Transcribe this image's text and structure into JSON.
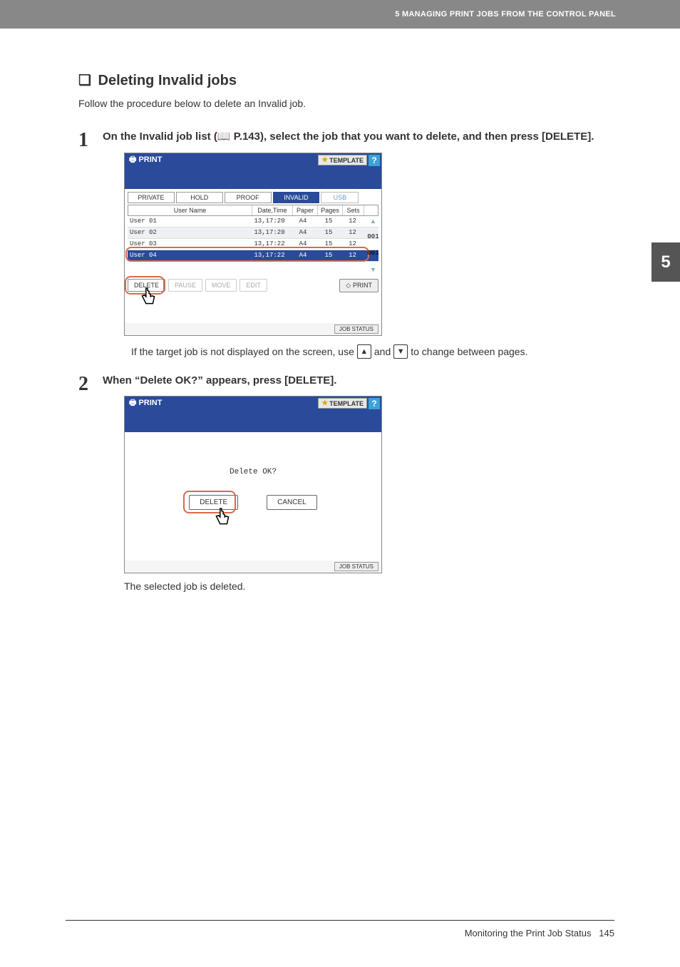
{
  "header": {
    "chapter_label": "5 MANAGING PRINT JOBS FROM THE CONTROL PANEL"
  },
  "chapter_tab": "5",
  "section": {
    "title": "Deleting Invalid jobs",
    "intro": "Follow the procedure below to delete an Invalid job."
  },
  "step1": {
    "num": "1",
    "heading_a": "On the Invalid job list (",
    "heading_ref": "P.143",
    "heading_b": "), select the job that you want to delete, and then press [DELETE].",
    "note_a": "If the target job is not displayed on the screen, use",
    "note_b": "and",
    "note_c": "to change between pages."
  },
  "step2": {
    "num": "2",
    "heading": "When “Delete OK?” appears, press [DELETE].",
    "after": "The selected job is deleted."
  },
  "panel1": {
    "title": "PRINT",
    "template": "TEMPLATE",
    "help": "?",
    "tabs": {
      "private": "PRIVATE",
      "hold": "HOLD",
      "proof": "PROOF",
      "invalid": "INVALID",
      "usb": "USB"
    },
    "cols": {
      "user": "User Name",
      "dt": "Date,Time",
      "paper": "Paper",
      "pages": "Pages",
      "sets": "Sets"
    },
    "rows": [
      {
        "user": "User 01",
        "dt": "13,17:20",
        "paper": "A4",
        "pages": "15",
        "sets": "12"
      },
      {
        "user": "User 02",
        "dt": "13,17:20",
        "paper": "A4",
        "pages": "15",
        "sets": "12"
      },
      {
        "user": "User 03",
        "dt": "13,17:22",
        "paper": "A4",
        "pages": "15",
        "sets": "12"
      },
      {
        "user": "User 04",
        "dt": "13,17:22",
        "paper": "A4",
        "pages": "15",
        "sets": "12"
      }
    ],
    "counter_a": "001",
    "counter_b": "001",
    "actions": {
      "delete": "DELETE",
      "pause": "PAUSE",
      "move": "MOVE",
      "edit": "EDIT",
      "print": "PRINT"
    },
    "jobstatus": "JOB STATUS"
  },
  "panel2": {
    "title": "PRINT",
    "template": "TEMPLATE",
    "help": "?",
    "message": "Delete OK?",
    "delete": "DELETE",
    "cancel": "CANCEL",
    "jobstatus": "JOB STATUS"
  },
  "footer": {
    "section": "Monitoring the Print Job Status",
    "page": "145"
  }
}
